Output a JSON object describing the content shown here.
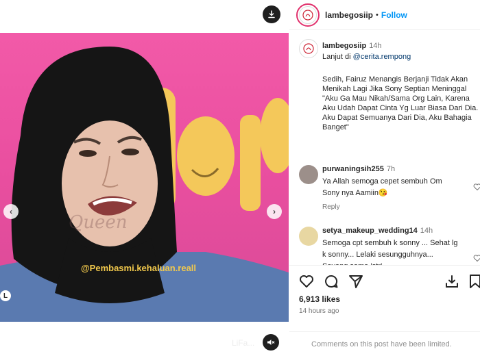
{
  "post": {
    "overlay_text": "@Pembasmi.kehaluan.reall",
    "ghost_text": "LiFa..."
  },
  "header": {
    "username": "lambegosiip",
    "separator": "•",
    "follow_label": "Follow"
  },
  "caption": {
    "username": "lambegosiip",
    "time": "14h",
    "line2_prefix": "Lanjut di ",
    "mention": "@cerita.rempong",
    "body": "Sedih, Fairuz Menangis Berjanji Tidak Akan Menikah Lagi Jika Sony Septian Meninggal \"Aku Ga Mau Nikah/Sama Org Lain, Karena Aku Udah Dapat Cinta Yg Luar Biasa Dari Dia. Aku Dapat Semuanya Dari Dia, Aku Bahagia Banget\""
  },
  "comments": [
    {
      "username": "purwaningsih255",
      "time": "7h",
      "text": "Ya Allah semoga cepet sembuh Om Sony nya Aamiin😘",
      "reply_label": "Reply"
    },
    {
      "username": "setya_makeup_wedding14",
      "time": "14h",
      "text": "Semoga cpt sembuh k sonny ... Sehat lg k sonny... Lelaki sesungguhnya... Sayang sama istri"
    }
  ],
  "actions": {
    "likes": "6,913 likes",
    "time_ago": "14 hours ago",
    "limited_text": "Comments on this post have been limited."
  },
  "icons": {
    "download": "download-icon",
    "mute": "speaker-muted-icon",
    "heart": "heart-icon",
    "comment": "comment-icon",
    "share": "share-icon",
    "save": "save-icon"
  },
  "colors": {
    "accent": "#0095f6",
    "background_pink": "#ea4fa0",
    "overlay_text": "#f2c94c"
  }
}
